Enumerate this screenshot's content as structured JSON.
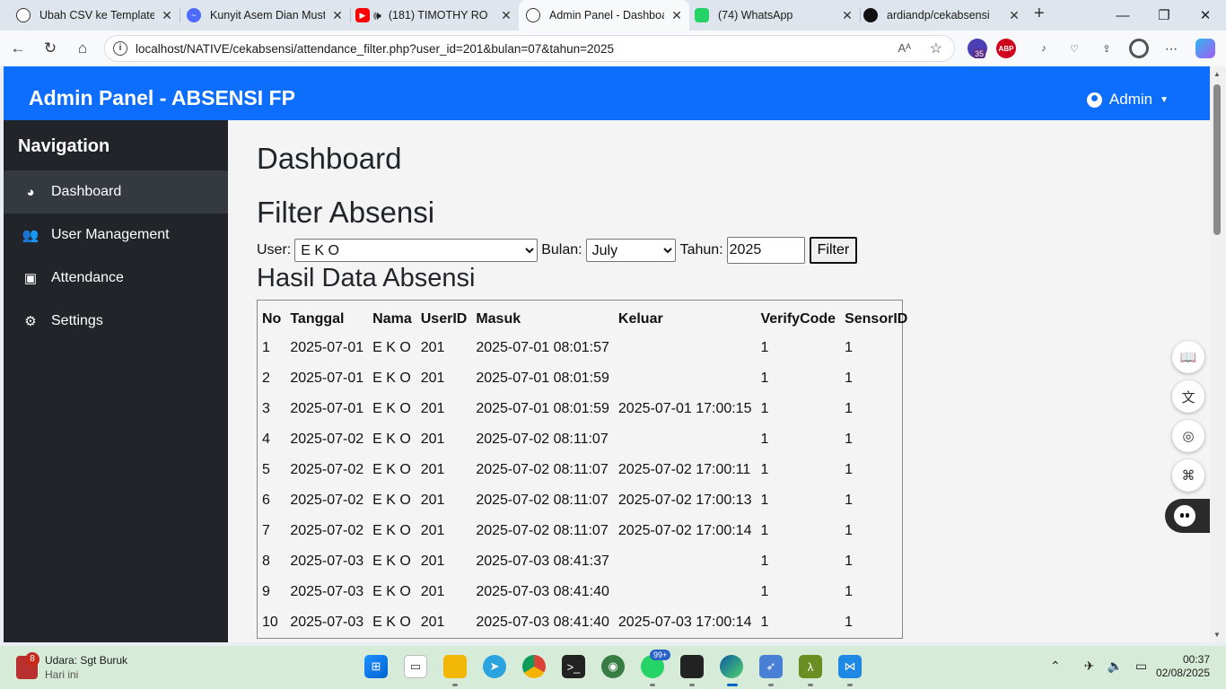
{
  "browser": {
    "tabs": [
      {
        "title": "Ubah CSV ke Template",
        "icon": "chatgpt-icon"
      },
      {
        "title": "Kunyit Asem Dian Musti",
        "icon": "deepseek-icon"
      },
      {
        "title": "(181) TIMOTHY RO",
        "icon": "youtube-icon"
      },
      {
        "title": "Admin Panel - Dashboard",
        "icon": "globe-icon"
      },
      {
        "title": "(74) WhatsApp",
        "icon": "whatsapp-icon"
      },
      {
        "title": "ardiandp/cekabsensi",
        "icon": "github-icon"
      }
    ],
    "url": "localhost/NATIVE/cekabsensi/attendance_filter.php?user_id=201&bulan=07&tahun=2025",
    "ext_badge_count": "35",
    "ext_abp_label": "ABP"
  },
  "header": {
    "brand": "Admin Panel - ABSENSI FP",
    "user": "Admin"
  },
  "sidebar": {
    "title": "Navigation",
    "items": [
      {
        "label": "Dashboard",
        "icon": "dashboard-icon",
        "active": true
      },
      {
        "label": "User Management",
        "icon": "users-icon"
      },
      {
        "label": "Attendance",
        "icon": "calendar-check-icon"
      },
      {
        "label": "Settings",
        "icon": "gear-icon"
      }
    ]
  },
  "main": {
    "page_title": "Dashboard",
    "filter_title": "Filter Absensi",
    "filter": {
      "user_label": "User:",
      "user_value": "E K O",
      "month_label": "Bulan:",
      "month_value": "July",
      "year_label": "Tahun:",
      "year_value": "2025",
      "button_label": "Filter"
    },
    "result_title": "Hasil Data Absensi",
    "table": {
      "headers": [
        "No",
        "Tanggal",
        "Nama",
        "UserID",
        "Masuk",
        "Keluar",
        "VerifyCode",
        "SensorID"
      ],
      "rows": [
        [
          "1",
          "2025-07-01",
          "E K O",
          "201",
          "2025-07-01 08:01:57",
          "",
          "1",
          "1"
        ],
        [
          "2",
          "2025-07-01",
          "E K O",
          "201",
          "2025-07-01 08:01:59",
          "",
          "1",
          "1"
        ],
        [
          "3",
          "2025-07-01",
          "E K O",
          "201",
          "2025-07-01 08:01:59",
          "2025-07-01 17:00:15",
          "1",
          "1"
        ],
        [
          "4",
          "2025-07-02",
          "E K O",
          "201",
          "2025-07-02 08:11:07",
          "",
          "1",
          "1"
        ],
        [
          "5",
          "2025-07-02",
          "E K O",
          "201",
          "2025-07-02 08:11:07",
          "2025-07-02 17:00:11",
          "1",
          "1"
        ],
        [
          "6",
          "2025-07-02",
          "E K O",
          "201",
          "2025-07-02 08:11:07",
          "2025-07-02 17:00:13",
          "1",
          "1"
        ],
        [
          "7",
          "2025-07-02",
          "E K O",
          "201",
          "2025-07-02 08:11:07",
          "2025-07-02 17:00:14",
          "1",
          "1"
        ],
        [
          "8",
          "2025-07-03",
          "E K O",
          "201",
          "2025-07-03 08:41:37",
          "",
          "1",
          "1"
        ],
        [
          "9",
          "2025-07-03",
          "E K O",
          "201",
          "2025-07-03 08:41:40",
          "",
          "1",
          "1"
        ],
        [
          "10",
          "2025-07-03",
          "E K O",
          "201",
          "2025-07-03 08:41:40",
          "2025-07-03 17:00:14",
          "1",
          "1"
        ]
      ]
    }
  },
  "taskbar": {
    "weather_badge": "8",
    "weather_title": "Udara: Sgt Buruk",
    "weather_sub": "Hari ini",
    "whatsapp_badge": "99+",
    "time": "00:37",
    "date": "02/08/2025"
  },
  "colors": {
    "brand_blue": "#0d6efd",
    "sidebar_dark": "#212529",
    "taskbar_green": "#d7ebd9"
  }
}
